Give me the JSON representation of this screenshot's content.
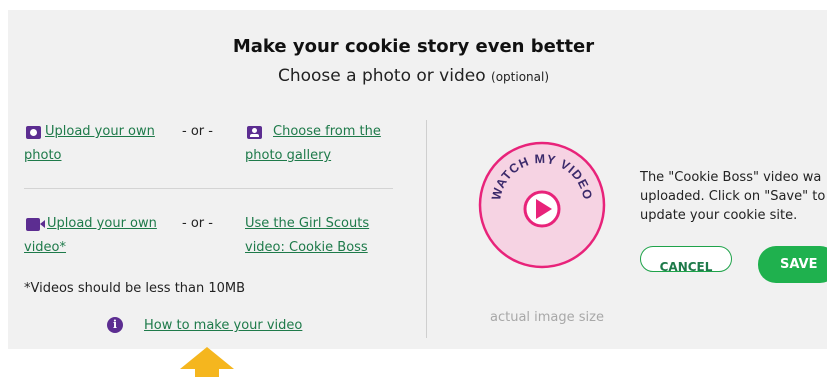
{
  "header": {
    "title": "Make your cookie story even better",
    "subtitle": "Choose a photo or video",
    "subtitle_optional": "(optional)"
  },
  "photo_options": {
    "upload_line1": "Upload your own",
    "upload_line2": "photo",
    "separator": "- or -",
    "gallery_line1": "Choose from the",
    "gallery_line2": "photo gallery"
  },
  "video_options": {
    "upload_line1": "Upload your own",
    "upload_line2": "video*",
    "separator": "- or -",
    "girlscouts_line1": "Use the Girl Scouts",
    "girlscouts_line2": "video: Cookie Boss"
  },
  "note": "*Videos should be less than 10MB",
  "help_link": "How to make your video",
  "preview": {
    "badge_text": "WATCH MY VIDEO",
    "caption": "actual image size"
  },
  "message": {
    "line1": "The \"Cookie Boss\" video wa",
    "line2": "uploaded. Click on \"Save\" to",
    "line3": "update your cookie site."
  },
  "buttons": {
    "cancel": "CANCEL",
    "save": "SAVE"
  },
  "colors": {
    "link": "#1e7a4a",
    "icon": "#5c2d91",
    "save": "#1fb14e",
    "badge": "#e8237a",
    "arrow": "#f5b61e"
  }
}
